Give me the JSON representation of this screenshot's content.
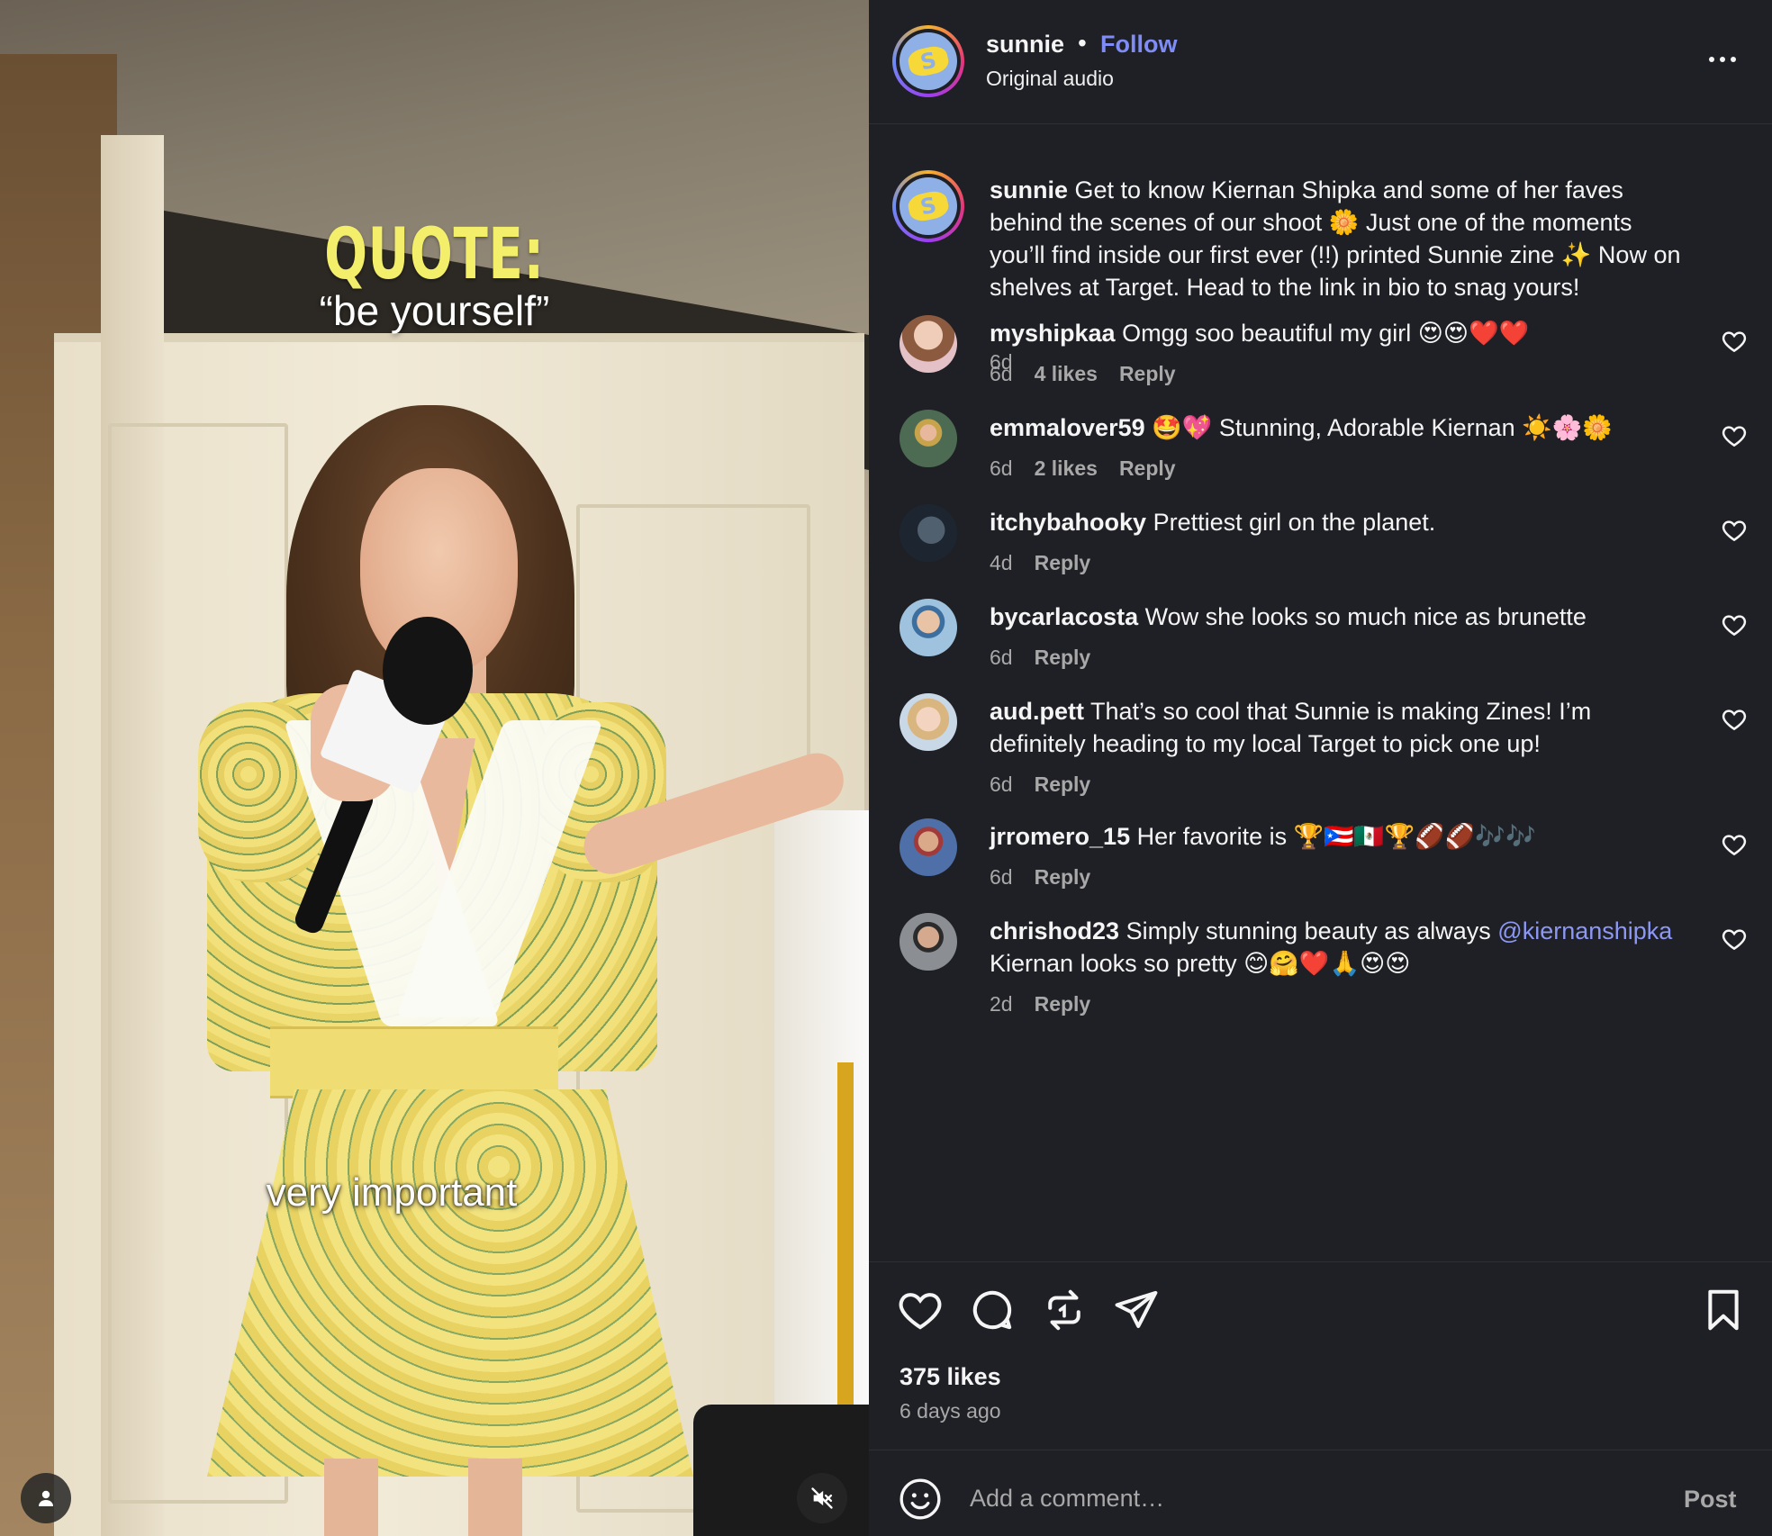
{
  "video": {
    "quote_title": "QUOTE:",
    "quote_text": "“be yourself”",
    "caption": "very important"
  },
  "header": {
    "username": "sunnie",
    "separator": "•",
    "follow_label": "Follow",
    "audio": "Original audio"
  },
  "post_caption": {
    "username": "sunnie",
    "text": "Get to know Kiernan Shipka and some of her faves behind the scenes of our shoot 🌼 Just one of the moments you’ll find inside our first ever (!!) printed Sunnie zine ✨ Now on shelves at Target. Head to the link in bio to snag yours!",
    "time": "6d"
  },
  "comments": [
    {
      "username": "myshipkaa",
      "text": "Omgg soo beautiful my girl 😍😍❤️❤️",
      "mention": "",
      "text_after": "",
      "time": "6d",
      "likes": "4 likes",
      "reply": "Reply",
      "avatar_color": "#c98f7c"
    },
    {
      "username": "emmalover59",
      "text": "🤩💖 Stunning, Adorable Kiernan ☀️🌸🌼",
      "mention": "",
      "text_after": "",
      "time": "6d",
      "likes": "2 likes",
      "reply": "Reply",
      "avatar_color": "#4d6b52"
    },
    {
      "username": "itchybahooky",
      "text": "Prettiest girl on the planet.",
      "mention": "",
      "text_after": "",
      "time": "4d",
      "likes": "",
      "reply": "Reply",
      "avatar_color": "#2f3f4f"
    },
    {
      "username": "bycarlacosta",
      "text": "Wow she looks so much nice as brunette",
      "mention": "",
      "text_after": "",
      "time": "6d",
      "likes": "",
      "reply": "Reply",
      "avatar_color": "#7aa6c4"
    },
    {
      "username": "aud.pett",
      "text": "That’s so cool that Sunnie is making Zines! I’m definitely heading to my local Target to pick one up!",
      "mention": "",
      "text_after": "",
      "time": "6d",
      "likes": "",
      "reply": "Reply",
      "avatar_color": "#d8c3a8"
    },
    {
      "username": "jrromero_15",
      "text": "Her favorite is 🏆🇵🇷🇲🇽🏆🏈🏈🎶🎶",
      "mention": "",
      "text_after": "",
      "time": "6d",
      "likes": "",
      "reply": "Reply",
      "avatar_color": "#4e6fa8"
    },
    {
      "username": "chrishod23",
      "text": "Simply stunning beauty as always",
      "mention": "@kiernanshipka",
      "text_after": "Kiernan looks so pretty 😊🤗❤️🙏😍😍",
      "time": "2d",
      "likes": "",
      "reply": "Reply",
      "avatar_color": "#5b5e63"
    }
  ],
  "footer": {
    "likes": "375 likes",
    "time_ago": "6 days ago",
    "comment_placeholder": "Add a comment…",
    "post_label": "Post"
  },
  "icons": [
    "user-icon",
    "mute-icon",
    "more-icon",
    "heart-icon",
    "comment-icon",
    "repost-icon",
    "share-icon",
    "bookmark-icon",
    "emoji-icon"
  ],
  "colors": {
    "panel_bg": "#1f2025",
    "accent": "#7f8cf5",
    "muted": "#a8a8a8",
    "quote_yellow": "#f4ef6b"
  }
}
